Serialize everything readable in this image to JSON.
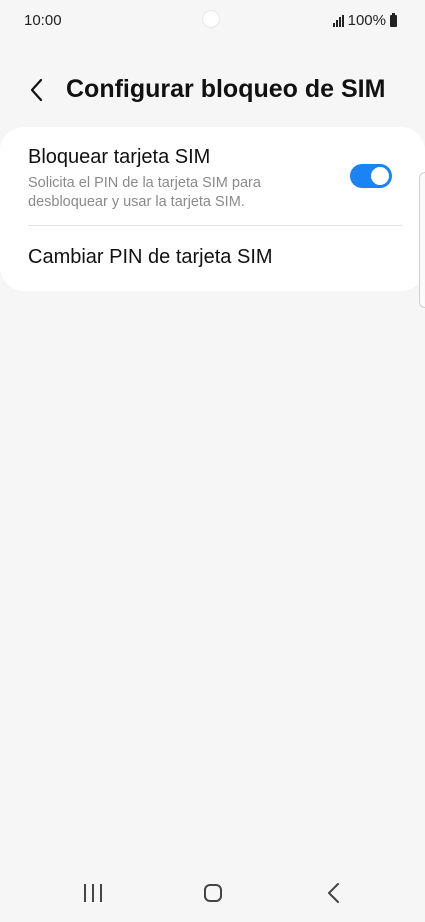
{
  "status_bar": {
    "time": "10:00",
    "battery_text": "100%",
    "signal_icon": "signal-bars-icon",
    "battery_icon": "battery-icon"
  },
  "header": {
    "title": "Configurar bloqueo de SIM",
    "back_icon": "chevron-left-icon"
  },
  "settings": {
    "lock_sim": {
      "title": "Bloquear tarjeta SIM",
      "description": "Solicita el PIN de la tarjeta SIM para desbloquear y usar la tarjeta SIM.",
      "enabled": true
    },
    "change_pin": {
      "title": "Cambiar PIN de tarjeta SIM"
    }
  },
  "colors": {
    "accent": "#1a84f5",
    "background": "#f6f6f6",
    "card": "#ffffff",
    "secondary_text": "#8a8a8a"
  },
  "nav_bar": {
    "recent_icon": "recent-apps-icon",
    "home_icon": "home-icon",
    "back_icon": "back-icon"
  }
}
